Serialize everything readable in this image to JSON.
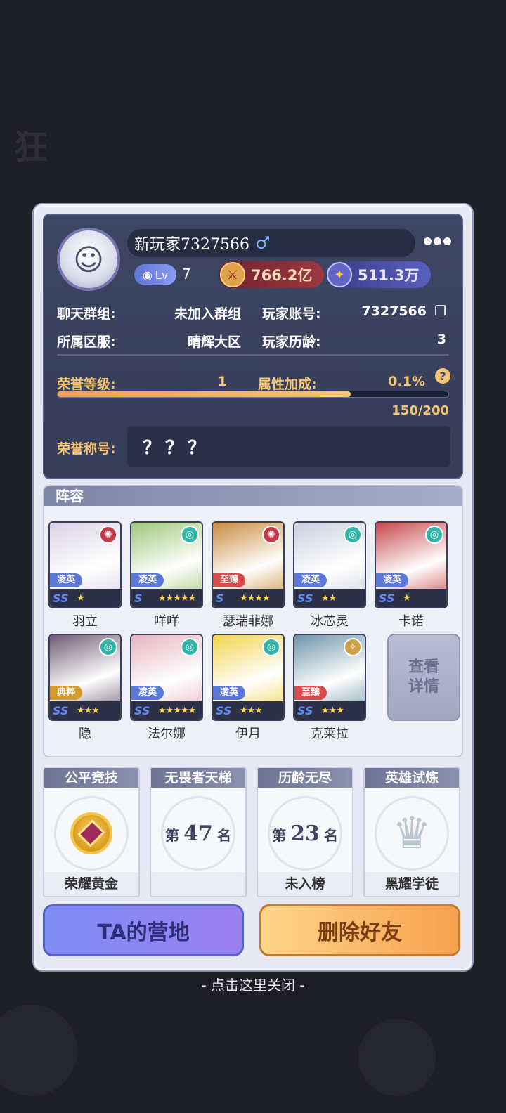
{
  "profile": {
    "name": "新玩家7327566",
    "gender_symbol": "♂",
    "level_label": "Lv",
    "level": "7",
    "currency_power": "766.2亿",
    "currency_stars": "511.3万",
    "chat_group_label": "聊天群组:",
    "chat_group_value": "未加入群组",
    "account_label": "玩家账号:",
    "account_value": "7327566",
    "server_label": "所属区服:",
    "server_value": "晴辉大区",
    "age_label": "玩家历龄:",
    "age_value": "3",
    "honor_level_label": "荣誉等级:",
    "honor_level_value": "1",
    "attr_bonus_label": "属性加成:",
    "attr_bonus_value": "0.1%",
    "honor_progress_text": "150/200",
    "honor_progress": 0.75,
    "honor_title_label": "荣誉称号:",
    "honor_title_value": "？？？"
  },
  "roster": {
    "title": "阵容",
    "view_detail": "查看详情",
    "heroes": [
      {
        "name": "羽立",
        "rank": "凌英",
        "grade": "SS",
        "stars": "★",
        "element": "fire",
        "rank_color": "#5b78d8",
        "bg": "#d9d2e6"
      },
      {
        "name": "咩咩",
        "rank": "凌英",
        "grade": "S",
        "stars": "★★★★★",
        "element": "wind",
        "rank_color": "#5b78d8",
        "bg": "#9dc77a"
      },
      {
        "name": "瑟瑞菲娜",
        "rank": "至臻",
        "grade": "S",
        "stars": "★★★★",
        "element": "fire",
        "rank_color": "#d94b4b",
        "bg": "#c98a3d"
      },
      {
        "name": "冰芯灵",
        "rank": "凌英",
        "grade": "SS",
        "stars": "★★",
        "element": "wind",
        "rank_color": "#5b78d8",
        "bg": "#c9cfdf"
      },
      {
        "name": "卡诺",
        "rank": "凌英",
        "grade": "SS",
        "stars": "★",
        "element": "wind",
        "rank_color": "#5b78d8",
        "bg": "#c6484a"
      },
      {
        "name": "隐",
        "rank": "典粹",
        "grade": "SS",
        "stars": "★★★",
        "element": "wind",
        "rank_color": "#d59a2a",
        "bg": "#6e5a72"
      },
      {
        "name": "法尔娜",
        "rank": "凌英",
        "grade": "SS",
        "stars": "★★★★★",
        "element": "wind",
        "rank_color": "#5b78d8",
        "bg": "#e7b4c0"
      },
      {
        "name": "伊月",
        "rank": "凌英",
        "grade": "SS",
        "stars": "★★★",
        "element": "wind",
        "rank_color": "#5b78d8",
        "bg": "#f1d34e"
      },
      {
        "name": "克莱拉",
        "rank": "至臻",
        "grade": "SS",
        "stars": "★★★",
        "element": "light",
        "rank_color": "#d94b4b",
        "bg": "#6d94a8"
      }
    ]
  },
  "stats": [
    {
      "title": "公平竞技",
      "footer": "荣耀黄金"
    },
    {
      "title": "无畏者天梯",
      "prefix": "第",
      "number": "47",
      "suffix": "名",
      "footer": ""
    },
    {
      "title": "历龄无尽",
      "prefix": "第",
      "number": "23",
      "suffix": "名",
      "footer": "未入榜"
    },
    {
      "title": "英雄试炼",
      "footer": "黑耀学徒"
    }
  ],
  "buttons": {
    "camp": "TA的营地",
    "delete": "删除好友"
  },
  "close_hint": "- 点击这里关闭 -"
}
